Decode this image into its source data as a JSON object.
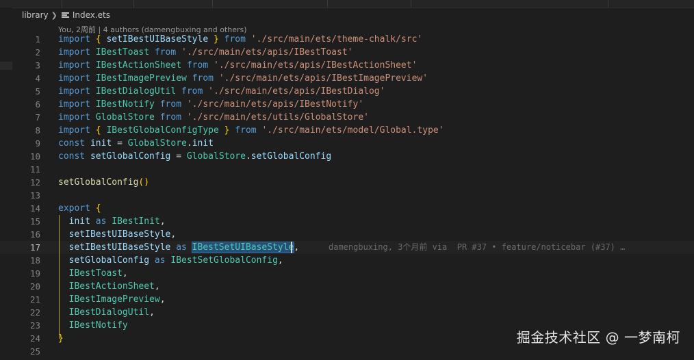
{
  "breadcrumb": {
    "folder": "library",
    "file": "Index.ets"
  },
  "blame_header": "You, 2周前 | 4 authors (damengbuxing and others)",
  "inline_blame": "damengbuxing, 3个月前 via  PR #37 • feature/noticebar (#37) …",
  "active_line": 17,
  "watermark": "掘金技术社区 @ 一梦南柯",
  "lines": [
    {
      "n": "1",
      "tokens": [
        [
          "import",
          "kw"
        ],
        [
          " ",
          "punc"
        ],
        [
          "{",
          "brace-y"
        ],
        [
          " setIBestUIBaseStyle ",
          "var"
        ],
        [
          "}",
          "brace-y"
        ],
        [
          " ",
          "punc"
        ],
        [
          "from",
          "kw"
        ],
        [
          " ",
          "punc"
        ],
        [
          "'./src/main/ets/theme-chalk/src'",
          "str"
        ]
      ]
    },
    {
      "n": "2",
      "tokens": [
        [
          "import",
          "kw"
        ],
        [
          " IBestToast ",
          "cls"
        ],
        [
          "from",
          "kw"
        ],
        [
          " ",
          "punc"
        ],
        [
          "'./src/main/ets/apis/IBestToast'",
          "str"
        ]
      ]
    },
    {
      "n": "3",
      "tokens": [
        [
          "import",
          "kw"
        ],
        [
          " IBestActionSheet ",
          "cls"
        ],
        [
          "from",
          "kw"
        ],
        [
          " ",
          "punc"
        ],
        [
          "'./src/main/ets/apis/IBestActionSheet'",
          "str"
        ]
      ]
    },
    {
      "n": "4",
      "tokens": [
        [
          "import",
          "kw"
        ],
        [
          " IBestImagePreview ",
          "cls"
        ],
        [
          "from",
          "kw"
        ],
        [
          " ",
          "punc"
        ],
        [
          "'./src/main/ets/apis/IBestImagePreview'",
          "str"
        ]
      ]
    },
    {
      "n": "5",
      "tokens": [
        [
          "import",
          "kw"
        ],
        [
          " IBestDialogUtil ",
          "cls"
        ],
        [
          "from",
          "kw"
        ],
        [
          " ",
          "punc"
        ],
        [
          "'./src/main/ets/apis/IBestDialog'",
          "str"
        ]
      ]
    },
    {
      "n": "6",
      "tokens": [
        [
          "import",
          "kw"
        ],
        [
          " IBestNotify ",
          "cls"
        ],
        [
          "from",
          "kw"
        ],
        [
          " ",
          "punc"
        ],
        [
          "'./src/main/ets/apis/IBestNotify'",
          "str"
        ]
      ]
    },
    {
      "n": "7",
      "tokens": [
        [
          "import",
          "kw"
        ],
        [
          " GlobalStore ",
          "cls"
        ],
        [
          "from",
          "kw"
        ],
        [
          " ",
          "punc"
        ],
        [
          "'./src/main/ets/utils/GlobalStore'",
          "str"
        ]
      ]
    },
    {
      "n": "8",
      "tokens": [
        [
          "import",
          "kw"
        ],
        [
          " ",
          "punc"
        ],
        [
          "{",
          "brace-y"
        ],
        [
          " IBestGlobalConfigType ",
          "cls"
        ],
        [
          "}",
          "brace-y"
        ],
        [
          " ",
          "punc"
        ],
        [
          "from",
          "kw"
        ],
        [
          " ",
          "punc"
        ],
        [
          "'./src/main/ets/model/Global.type'",
          "str"
        ]
      ]
    },
    {
      "n": "9",
      "tokens": [
        [
          "const",
          "kw"
        ],
        [
          " init ",
          "var"
        ],
        [
          "= ",
          "punc"
        ],
        [
          "GlobalStore",
          "cls"
        ],
        [
          ".",
          "punc"
        ],
        [
          "init",
          "var"
        ]
      ]
    },
    {
      "n": "10",
      "tokens": [
        [
          "const",
          "kw"
        ],
        [
          " setGlobalConfig ",
          "var"
        ],
        [
          "= ",
          "punc"
        ],
        [
          "GlobalStore",
          "cls"
        ],
        [
          ".",
          "punc"
        ],
        [
          "setGlobalConfig",
          "var"
        ]
      ]
    },
    {
      "n": "11",
      "tokens": []
    },
    {
      "n": "12",
      "tokens": [
        [
          "setGlobalConfig",
          "fn"
        ],
        [
          "()",
          "brace-y"
        ]
      ]
    },
    {
      "n": "13",
      "tokens": []
    },
    {
      "n": "14",
      "tokens": [
        [
          "export",
          "kw"
        ],
        [
          " ",
          "punc"
        ],
        [
          "{",
          "brace-y"
        ]
      ]
    },
    {
      "n": "15",
      "tokens": [
        [
          "  init ",
          "var"
        ],
        [
          "as",
          "kw"
        ],
        [
          " IBestInit",
          "cls"
        ],
        [
          ",",
          "punc"
        ]
      ]
    },
    {
      "n": "16",
      "tokens": [
        [
          "  setIBestUIBaseStyle",
          "var"
        ],
        [
          ",",
          "punc"
        ]
      ]
    },
    {
      "n": "17",
      "tokens": [
        [
          "  setIBestUIBaseStyle ",
          "var"
        ],
        [
          "as",
          "kw"
        ],
        [
          " ",
          "punc"
        ],
        [
          "IBestSetUIBaseStyle",
          "cls hl"
        ],
        [
          ",",
          "punc"
        ]
      ]
    },
    {
      "n": "18",
      "tokens": [
        [
          "  setGlobalConfig ",
          "var"
        ],
        [
          "as",
          "kw"
        ],
        [
          " IBestSetGlobalConfig",
          "cls"
        ],
        [
          ",",
          "punc"
        ]
      ]
    },
    {
      "n": "19",
      "tokens": [
        [
          "  IBestToast",
          "cls"
        ],
        [
          ",",
          "punc"
        ]
      ]
    },
    {
      "n": "20",
      "tokens": [
        [
          "  IBestActionSheet",
          "cls"
        ],
        [
          ",",
          "punc"
        ]
      ]
    },
    {
      "n": "21",
      "tokens": [
        [
          "  IBestImagePreview",
          "cls"
        ],
        [
          ",",
          "punc"
        ]
      ]
    },
    {
      "n": "22",
      "tokens": [
        [
          "  IBestDialogUtil",
          "cls"
        ],
        [
          ",",
          "punc"
        ]
      ]
    },
    {
      "n": "23",
      "tokens": [
        [
          "  IBestNotify",
          "cls"
        ]
      ]
    },
    {
      "n": "24",
      "tokens": [
        [
          "}",
          "brace-y"
        ]
      ]
    },
    {
      "n": "25",
      "tokens": []
    }
  ]
}
